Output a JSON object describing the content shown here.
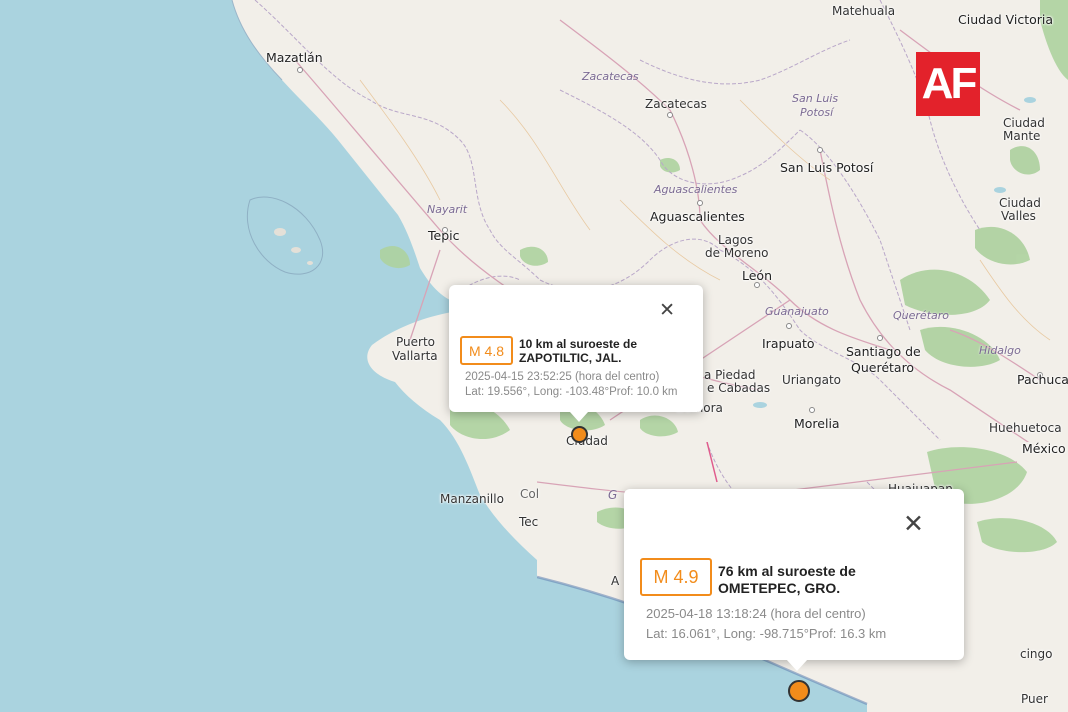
{
  "places": [
    {
      "id": "matehuala",
      "name": "Matehuala"
    },
    {
      "id": "ciudad-victoria",
      "name": "Ciudad Victoria"
    },
    {
      "id": "mazatlan",
      "name": "Mazatlán"
    },
    {
      "id": "zacatecas-state",
      "name": "Zacatecas"
    },
    {
      "id": "zacatecas",
      "name": "Zacatecas"
    },
    {
      "id": "slp-state-1",
      "name": "San Luis"
    },
    {
      "id": "slp-state-2",
      "name": "Potosí"
    },
    {
      "id": "ciudad-mante-1",
      "name": "Ciudad"
    },
    {
      "id": "ciudad-mante-2",
      "name": "Mante"
    },
    {
      "id": "slp",
      "name": "San Luis Potosí"
    },
    {
      "id": "ags-state",
      "name": "Aguascalientes"
    },
    {
      "id": "ags",
      "name": "Aguascalientes"
    },
    {
      "id": "nayarit",
      "name": "Nayarit"
    },
    {
      "id": "ciudad-valles-1",
      "name": "Ciudad"
    },
    {
      "id": "ciudad-valles-2",
      "name": "Valles"
    },
    {
      "id": "tepic",
      "name": "Tepic"
    },
    {
      "id": "lagos-1",
      "name": "Lagos"
    },
    {
      "id": "lagos-2",
      "name": "de Moreno"
    },
    {
      "id": "leon",
      "name": "León"
    },
    {
      "id": "guanajuato-state",
      "name": "Guanajuato"
    },
    {
      "id": "queretaro-state",
      "name": "Querétaro"
    },
    {
      "id": "puerto-vallarta-1",
      "name": "Puerto"
    },
    {
      "id": "puerto-vallarta-2",
      "name": "Vallarta"
    },
    {
      "id": "irapuato",
      "name": "Irapuato"
    },
    {
      "id": "santiago-1",
      "name": "Santiago de"
    },
    {
      "id": "santiago-2",
      "name": "Querétaro"
    },
    {
      "id": "hidalgo",
      "name": "Hidalgo"
    },
    {
      "id": "pachuca",
      "name": "Pachuca"
    },
    {
      "id": "la-piedad-1",
      "name": "a Piedad"
    },
    {
      "id": "la-piedad-2",
      "name": "e Cabadas"
    },
    {
      "id": "uriangato",
      "name": "Uriangato"
    },
    {
      "id": "zamora",
      "name": "Zamora"
    },
    {
      "id": "morelia",
      "name": "Morelia"
    },
    {
      "id": "huehuetoca",
      "name": "Huehuetoca"
    },
    {
      "id": "mexico",
      "name": "México"
    },
    {
      "id": "ciudad-guzman",
      "name": "Ciudad"
    },
    {
      "id": "huajuapan",
      "name": "Huajuapan"
    },
    {
      "id": "manzanillo",
      "name": "Manzanillo"
    },
    {
      "id": "colima-partial",
      "name": "Col"
    },
    {
      "id": "tecoman-partial",
      "name": "Tec"
    },
    {
      "id": "guerrero-partial",
      "name": "G"
    },
    {
      "id": "acapulco-partial",
      "name": "A"
    },
    {
      "id": "cingo-partial",
      "name": "cingo"
    },
    {
      "id": "puerto-partial",
      "name": "Puer"
    }
  ],
  "logo": {
    "text": "AF",
    "bg": "#e3222b"
  },
  "popups": [
    {
      "id": "zapotiltic",
      "magnitude": "M 4.8",
      "title_line1": "10 km al suroeste de",
      "title_line2": "ZAPOTILTIC, JAL.",
      "datetime": "2025-04-15   23:52:25 (hora del centro)",
      "coords": "Lat: 19.556°, Long: -103.48°Prof: 10.0 km",
      "close": "✕"
    },
    {
      "id": "ometepec",
      "magnitude": "M 4.9",
      "title_line1": "76 km al suroeste de",
      "title_line2": "OMETEPEC, GRO.",
      "datetime": "2025-04-18   13:18:24 (hora del centro)",
      "coords": "Lat: 16.061°, Long: -98.715°Prof: 16.3 km",
      "close": "✕"
    }
  ],
  "colors": {
    "sea": "#aad3df",
    "land": "#f2efe9",
    "accent": "#f28c1b",
    "forest": "#add19e"
  }
}
